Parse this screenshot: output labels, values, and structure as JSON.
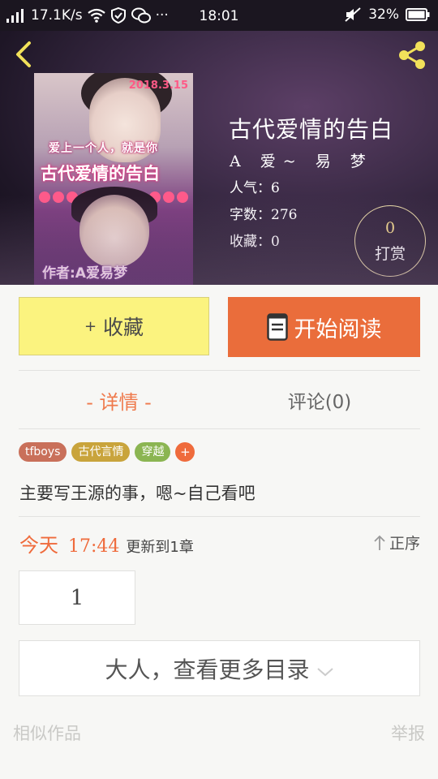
{
  "status_bar": {
    "speed": "17.1K/s",
    "time": "18:01",
    "battery": "32%",
    "more": "···"
  },
  "header": {
    "back_icon": "back-chevron-icon",
    "share_icon": "share-icon"
  },
  "cover": {
    "date": "2018.3.15",
    "tagline": "爱上一个人，就是你",
    "title": "古代爱情的告白",
    "author": "作者:A爱易梦"
  },
  "book": {
    "title": "古代爱情的告白",
    "author": "A 爱~ 易 梦",
    "popularity": "人气：6",
    "word_count": "字数：276",
    "favorites": "收藏：0"
  },
  "reward": {
    "count": "0",
    "label": "打赏"
  },
  "actions": {
    "collect_plus": "+",
    "collect_label": "收藏",
    "read_label": "开始阅读"
  },
  "tabs": {
    "detail": "- 详情 -",
    "comment": "评论(0)"
  },
  "tags": [
    {
      "label": "tfboys",
      "color": "#c9705a"
    },
    {
      "label": "古代言情",
      "color": "#c9a43c"
    },
    {
      "label": "穿越",
      "color": "#8bb552"
    }
  ],
  "tag_add": "+",
  "description": "主要写王源的事，嗯~自己看吧",
  "update": {
    "day": "今天",
    "time": "17:44",
    "note": "更新到1章",
    "sort_label": "正序"
  },
  "chapter": "1",
  "more_catalog": "大人，查看更多目录",
  "footer": {
    "similar": "相似作品",
    "report": "举报"
  },
  "colors": {
    "accent": "#ea6d3b",
    "collect_bg": "#fbf37f",
    "reward_num": "#f1d98c"
  }
}
